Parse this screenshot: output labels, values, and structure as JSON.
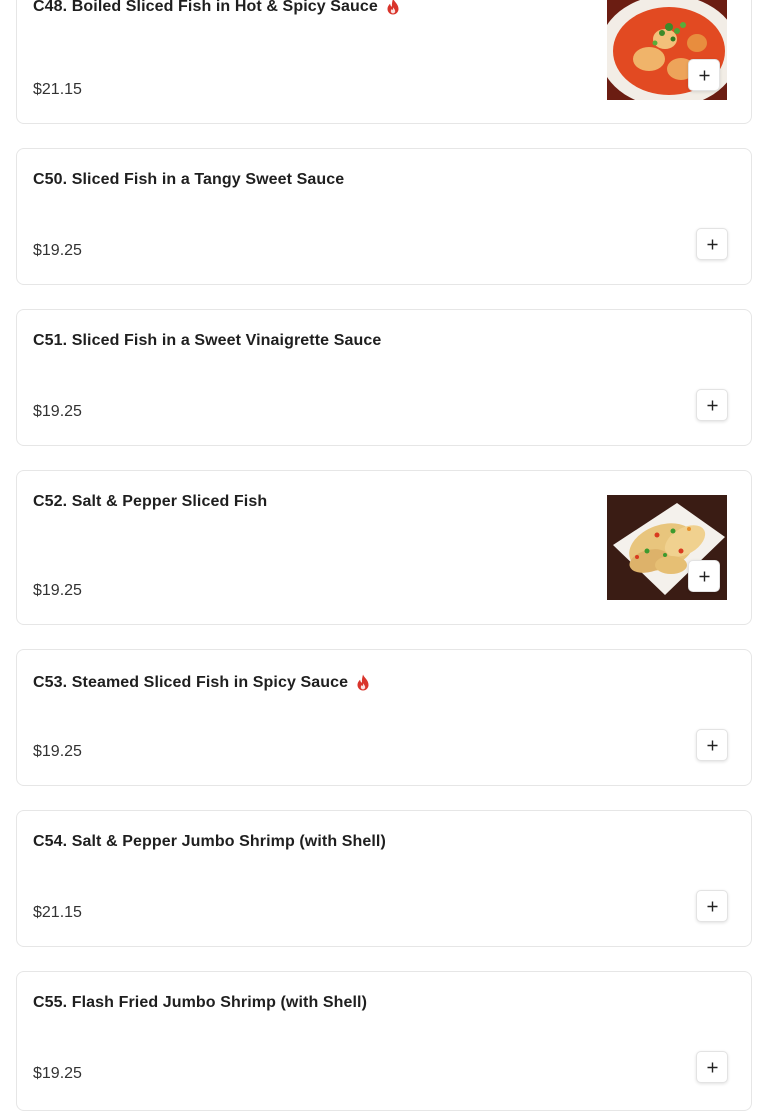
{
  "menu_items": [
    {
      "title": "C48. Boiled Sliced Fish in Hot & Spicy Sauce",
      "price": "$21.15",
      "spicy": true,
      "has_image": true
    },
    {
      "title": "C50. Sliced Fish in a Tangy Sweet Sauce",
      "price": "$19.25",
      "spicy": false,
      "has_image": false
    },
    {
      "title": "C51. Sliced Fish in a Sweet Vinaigrette Sauce",
      "price": "$19.25",
      "spicy": false,
      "has_image": false
    },
    {
      "title": "C52. Salt & Pepper Sliced Fish",
      "price": "$19.25",
      "spicy": false,
      "has_image": true
    },
    {
      "title": "C53. Steamed Sliced Fish in Spicy Sauce",
      "price": "$19.25",
      "spicy": true,
      "has_image": false
    },
    {
      "title": "C54. Salt & Pepper Jumbo Shrimp (with Shell)",
      "price": "$21.15",
      "spicy": false,
      "has_image": false
    },
    {
      "title": "C55. Flash Fried Jumbo Shrimp (with Shell)",
      "price": "$19.25",
      "spicy": false,
      "has_image": false
    }
  ],
  "icons": {
    "spicy": "flame-icon",
    "add": "plus-icon"
  },
  "colors": {
    "spicy": "#d9342b",
    "border": "#e6e6e6"
  }
}
